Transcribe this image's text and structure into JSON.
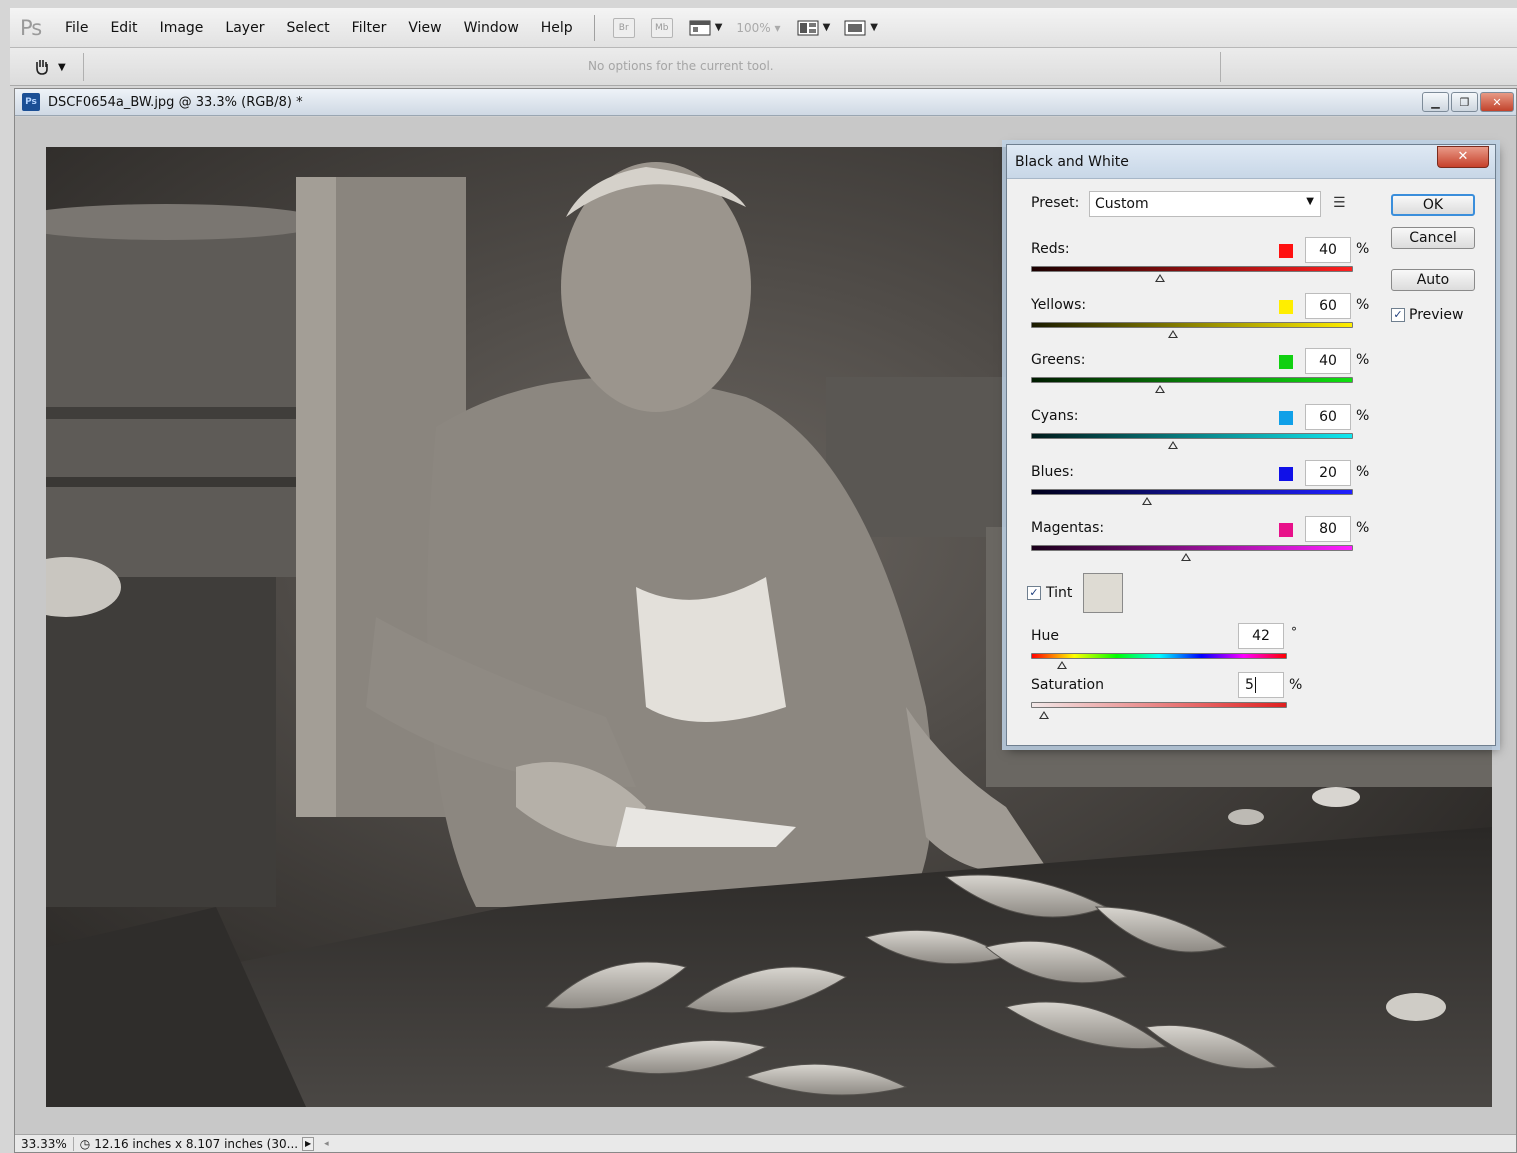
{
  "menubar": {
    "logo": "Ps",
    "items": [
      "File",
      "Edit",
      "Image",
      "Layer",
      "Select",
      "Filter",
      "View",
      "Window",
      "Help"
    ],
    "zoom_value": "100%",
    "br_label": "Br",
    "mb_label": "Mb"
  },
  "options_bar": {
    "message": "No options for the current tool."
  },
  "document": {
    "title": "DSCF0654a_BW.jpg @ 33.3% (RGB/8) *",
    "icon_label": "Ps"
  },
  "statusbar": {
    "zoom": "33.33%",
    "info": "12.16 inches x 8.107 inches (30..."
  },
  "dialog": {
    "title": "Black and White",
    "preset_label": "Preset:",
    "preset_value": "Custom",
    "buttons": {
      "ok": "OK",
      "cancel": "Cancel",
      "auto": "Auto"
    },
    "preview_label": "Preview",
    "preview_checked": true,
    "sliders": [
      {
        "label": "Reds:",
        "value": "40",
        "swatch": "#ff1010",
        "gradient": "linear-gradient(90deg,#1a0000,#ff2020)",
        "percent_sign": "%",
        "position": 0.4
      },
      {
        "label": "Yellows:",
        "value": "60",
        "swatch": "#ffee00",
        "gradient": "linear-gradient(90deg,#1a1a00,#ffee00)",
        "percent_sign": "%",
        "position": 0.44
      },
      {
        "label": "Greens:",
        "value": "40",
        "swatch": "#10d010",
        "gradient": "linear-gradient(90deg,#001a00,#10e010)",
        "percent_sign": "%",
        "position": 0.4
      },
      {
        "label": "Cyans:",
        "value": "60",
        "swatch": "#10a0e8",
        "gradient": "linear-gradient(90deg,#001a1a,#10e8f0)",
        "percent_sign": "%",
        "position": 0.44
      },
      {
        "label": "Blues:",
        "value": "20",
        "swatch": "#1010e8",
        "gradient": "linear-gradient(90deg,#00001a,#2020ff)",
        "percent_sign": "%",
        "position": 0.36
      },
      {
        "label": "Magentas:",
        "value": "80",
        "swatch": "#e8108a",
        "gradient": "linear-gradient(90deg,#1a001a,#ff20ff)",
        "percent_sign": "%",
        "position": 0.48
      }
    ],
    "tint": {
      "label": "Tint",
      "checked": true,
      "swatch_color": "#dedbd3",
      "hue_label": "Hue",
      "hue_value": "42",
      "hue_unit": "°",
      "hue_position": 0.12,
      "saturation_label": "Saturation",
      "saturation_value": "5",
      "saturation_unit": "%",
      "saturation_position": 0.05
    }
  }
}
